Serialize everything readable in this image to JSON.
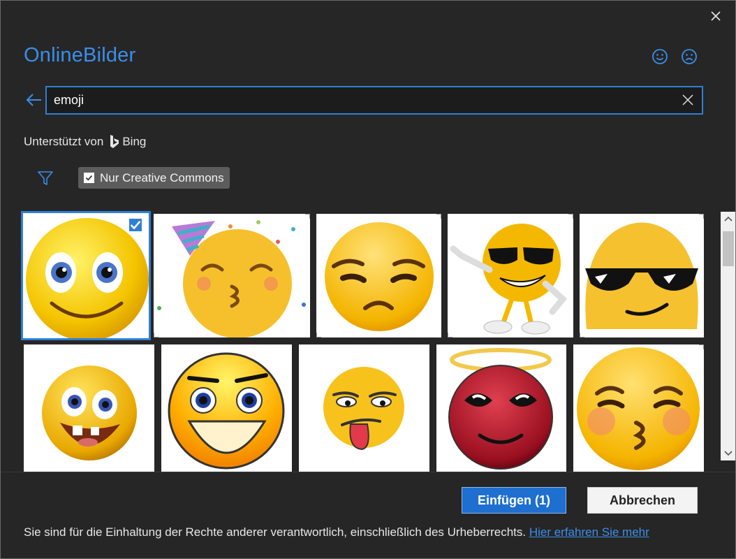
{
  "dialog": {
    "title": "OnlineBilder",
    "close_icon": "close-icon"
  },
  "feedback": {
    "smile_icon": "smile-icon",
    "frown_icon": "frown-icon"
  },
  "search": {
    "value": "emoji",
    "back_icon": "back-arrow-icon",
    "clear_icon": "clear-icon"
  },
  "powered_by": {
    "label": "Unterstützt von",
    "brand": "Bing"
  },
  "filters": {
    "filter_icon": "filter-icon",
    "creative_commons_label": "Nur Creative Commons",
    "creative_commons_checked": true
  },
  "results": {
    "selected_count": 1,
    "row1": [
      "Smiley gelb mit großen Augen",
      "Emoji mit Partyhut",
      "Skeptisches Emoji",
      "Cooles Emoji tanzend",
      "Emoji mit Sonnenbrille"
    ],
    "row2": [
      "Verrücktes Emoji",
      "Frecher Smiley",
      "Emoji mit Zunge",
      "Roter Engel-Emoji",
      "Küssendes Emoji"
    ]
  },
  "actions": {
    "insert_label": "Einfügen (1)",
    "cancel_label": "Abbrechen"
  },
  "footer": {
    "notice": "Sie sind für die Einhaltung der Rechte anderer verantwortlich, einschließlich des Urheberrechts. ",
    "link": "Hier erfahren Sie mehr"
  },
  "colors": {
    "accent": "#3b8eea",
    "background": "#262626",
    "insert_button": "#1e6fd0"
  }
}
